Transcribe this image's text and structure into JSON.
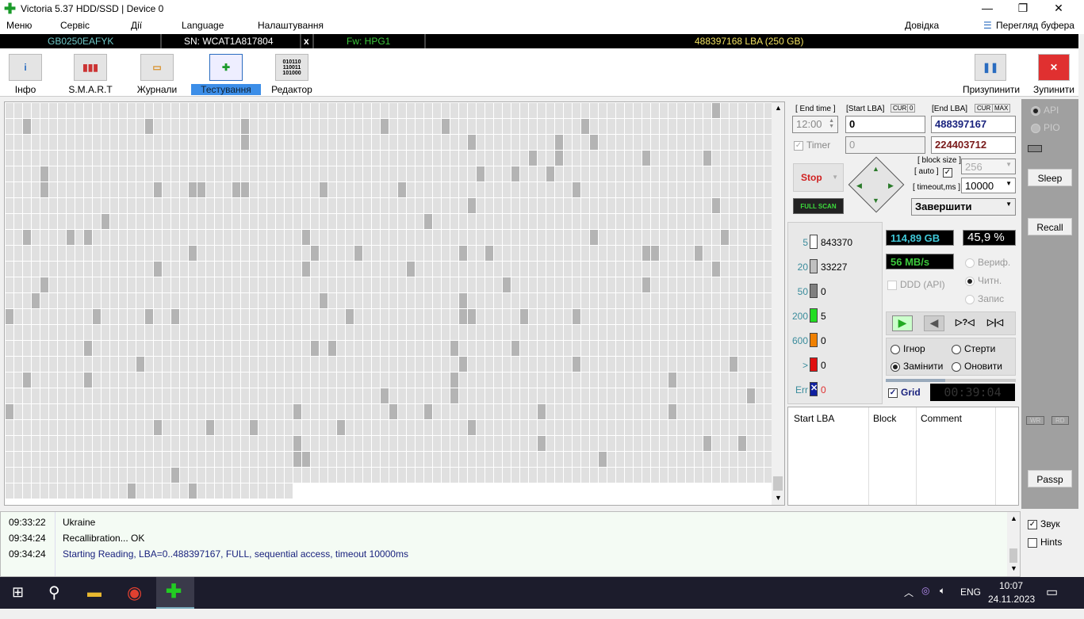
{
  "window": {
    "title": "Victoria 5.37 HDD/SSD | Device 0",
    "minimize": "—",
    "maximize": "❐",
    "close": "✕"
  },
  "menu": [
    "Меню",
    "Сервіс",
    "Дії",
    "Language",
    "Налаштування"
  ],
  "menu_right": {
    "help": "Довідка",
    "clipboard": "Перегляд буфера"
  },
  "device": {
    "model": "GB0250EAFYK",
    "serial": "SN: WCAT1A817804",
    "x": "x",
    "firmware": "Fw: HPG1",
    "capacity": "488397168 LBA (250 GB)"
  },
  "toolbar": {
    "items": [
      {
        "label": "Інфо",
        "icon": "info-icon"
      },
      {
        "label": "S.M.A.R.T",
        "icon": "smart-icon"
      },
      {
        "label": "Журнали",
        "icon": "logs-folder-icon"
      },
      {
        "label": "Тестування",
        "icon": "testing-icon",
        "active": true
      },
      {
        "label": "Редактор",
        "icon": "editor-binary-icon"
      }
    ],
    "pause": "Призупинити",
    "stop": "Зупинити"
  },
  "controls": {
    "end_time_label": "[ End time ]",
    "end_time": "12:00",
    "timer_label": "Timer",
    "start_lba_label": "[Start LBA]",
    "cur": "CUR",
    "zero": "0",
    "start_lba": "0",
    "start_lba2": "0",
    "end_lba_label": "[End LBA]",
    "max": "MAX",
    "end_lba": "488397167",
    "end_lba2": "224403712",
    "stop": "Stop",
    "full_scan": "FULL SCAN",
    "block_size_label": "[ block size ]",
    "auto_label": "[ auto ]",
    "block_size": "256",
    "timeout_label": "[ timeout,ms ]",
    "timeout": "10000",
    "action": "Завершити"
  },
  "legend": [
    {
      "ms": "5",
      "count": "843370",
      "color": "#ffffff"
    },
    {
      "ms": "20",
      "count": "33227",
      "color": "#c0c0c0"
    },
    {
      "ms": "50",
      "count": "0",
      "color": "#808080"
    },
    {
      "ms": "200",
      "count": "5",
      "color": "#22dd22"
    },
    {
      "ms": "600",
      "count": "0",
      "color": "#f08000"
    },
    {
      "ms": ">",
      "count": "0",
      "color": "#e01010"
    },
    {
      "ms": "Err",
      "count": "0",
      "color": "#1020a0"
    }
  ],
  "stats": {
    "size": "114,89 GB",
    "percent": "45,9  %",
    "speed": "56 MB/s",
    "ddd": "DDD (API)",
    "verify": "Вериф.",
    "read": "Читн.",
    "write": "Запис",
    "progress": 45.9
  },
  "repair": {
    "ignore": "Ігнор",
    "erase": "Стерти",
    "replace": "Замінити",
    "refresh": "Оновити",
    "selected": "Замінити"
  },
  "grid_label": "Grid",
  "elapsed": "00:39:04",
  "table": {
    "columns": [
      "Start LBA",
      "Block",
      "Comment"
    ]
  },
  "right": {
    "api": "API",
    "pio": "PIO",
    "sleep": "Sleep",
    "recall": "Recall",
    "wr": "WR",
    "rd": "RD",
    "passp": "Passp",
    "sound": "Звук",
    "hints": "Hints"
  },
  "log": [
    {
      "time": "09:33:22",
      "text": "Ukraine"
    },
    {
      "time": "09:34:24",
      "text": "Recallibration... OK"
    },
    {
      "time": "09:34:24",
      "text": "Starting Reading, LBA=0..488397167, FULL, sequential access, timeout 10000ms",
      "color": "#1a237e"
    }
  ],
  "taskbar": {
    "lang": "ENG",
    "time": "10:07",
    "date": "24.11.2023"
  }
}
